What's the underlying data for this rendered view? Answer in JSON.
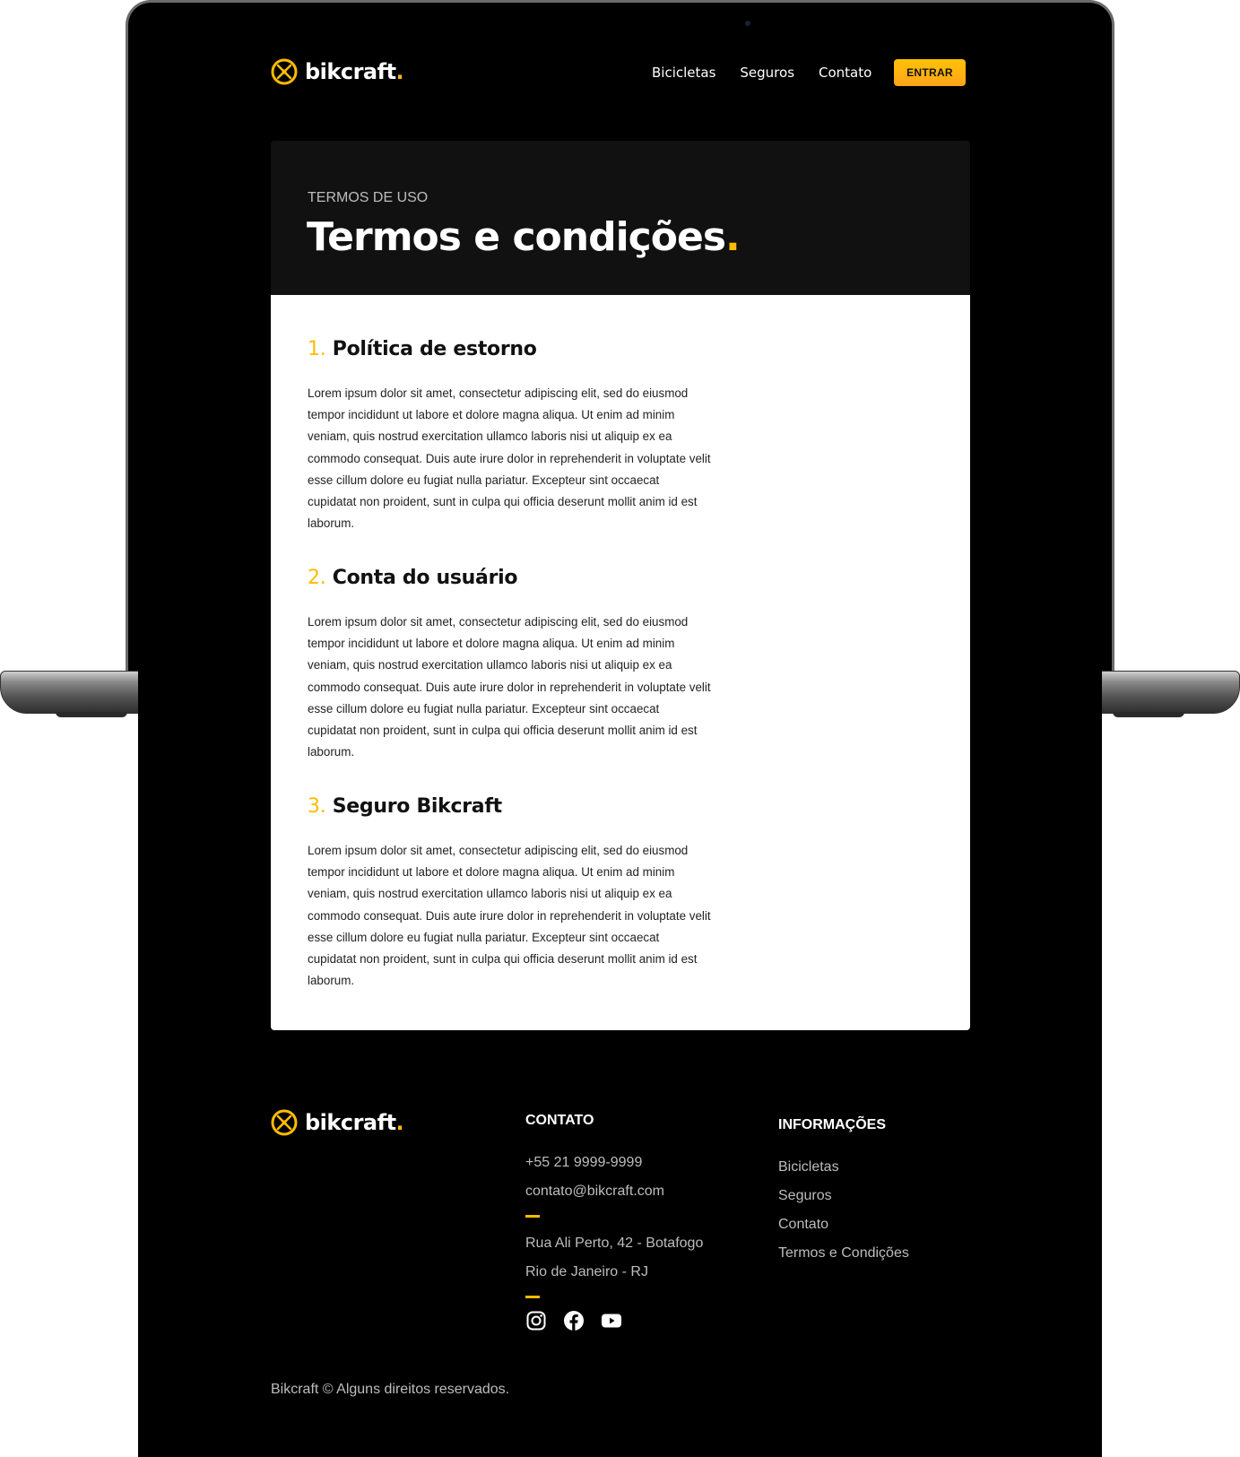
{
  "header": {
    "logo_text": "bikcraft",
    "logo_dot": ".",
    "nav": [
      "Bicicletas",
      "Seguros",
      "Contato"
    ],
    "cta_label": "ENTRAR"
  },
  "hero": {
    "eyebrow": "TERMOS DE USO",
    "title": "Termos e condições",
    "title_dot": "."
  },
  "sections": [
    {
      "number": "1.",
      "title": "Política de estorno",
      "body": "Lorem ipsum dolor sit amet, consectetur adipiscing elit, sed do eiusmod tempor incididunt ut labore et dolore magna aliqua. Ut enim ad minim veniam, quis nostrud exercitation ullamco laboris nisi ut aliquip ex ea commodo consequat. Duis aute irure dolor in reprehenderit in voluptate velit esse cillum dolore eu fugiat nulla pariatur. Excepteur sint occaecat cupidatat non proident, sunt in culpa qui officia deserunt mollit anim id est laborum."
    },
    {
      "number": "2.",
      "title": "Conta do usuário",
      "body": "Lorem ipsum dolor sit amet, consectetur adipiscing elit, sed do eiusmod tempor incididunt ut labore et dolore magna aliqua. Ut enim ad minim veniam, quis nostrud exercitation ullamco laboris nisi ut aliquip ex ea commodo consequat. Duis aute irure dolor in reprehenderit in voluptate velit esse cillum dolore eu fugiat nulla pariatur. Excepteur sint occaecat cupidatat non proident, sunt in culpa qui officia deserunt mollit anim id est laborum."
    },
    {
      "number": "3.",
      "title": "Seguro Bikcraft",
      "body": "Lorem ipsum dolor sit amet, consectetur adipiscing elit, sed do eiusmod tempor incididunt ut labore et dolore magna aliqua. Ut enim ad minim veniam, quis nostrud exercitation ullamco laboris nisi ut aliquip ex ea commodo consequat. Duis aute irure dolor in reprehenderit in voluptate velit esse cillum dolore eu fugiat nulla pariatur. Excepteur sint occaecat cupidatat non proident, sunt in culpa qui officia deserunt mollit anim id est laborum."
    }
  ],
  "footer": {
    "logo_text": "bikcraft",
    "logo_dot": ".",
    "contact": {
      "title": "CONTATO",
      "phone": "+55 21 9999-9999",
      "email": "contato@bikcraft.com",
      "address_line1": "Rua Ali Perto, 42 - Botafogo",
      "address_line2": "Rio de Janeiro - RJ",
      "socials": [
        "instagram-icon",
        "facebook-icon",
        "youtube-icon"
      ]
    },
    "info": {
      "title": "INFORMAÇÕES",
      "links": [
        "Bicicletas",
        "Seguros",
        "Contato",
        "Termos e Condições"
      ]
    },
    "copyright": "Bikcraft © Alguns direitos reservados."
  },
  "colors": {
    "accent": "#ffbb00",
    "background": "#000000",
    "card_dark": "#111111",
    "card_light": "#ffffff"
  }
}
